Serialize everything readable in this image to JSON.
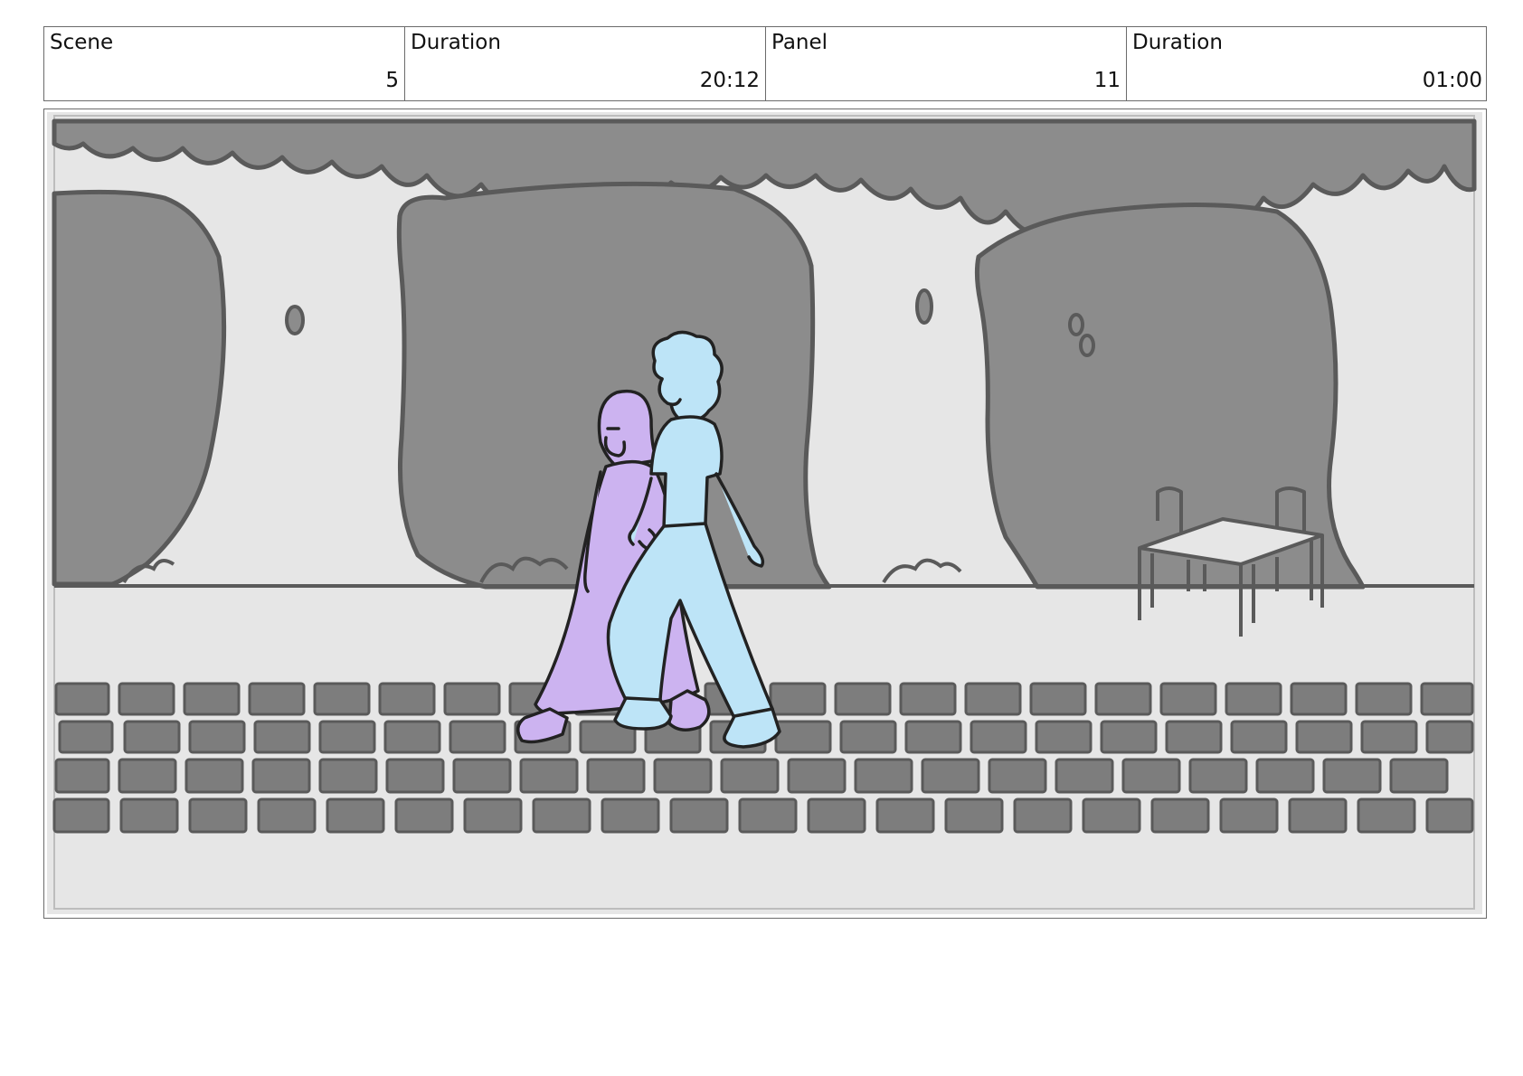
{
  "header": {
    "cells": [
      {
        "label": "Scene",
        "value": "5"
      },
      {
        "label": "Duration",
        "value": "20:12"
      },
      {
        "label": "Panel",
        "value": "11"
      },
      {
        "label": "Duration",
        "value": "01:00"
      }
    ]
  },
  "colors": {
    "sky": "#e6e6e6",
    "foliage": "#8c8c8c",
    "outline": "#5a5a5a",
    "cobble": "#7d7d7d",
    "woman": "#ccb3f0",
    "man": "#bde4f7",
    "ink": "#222222"
  }
}
